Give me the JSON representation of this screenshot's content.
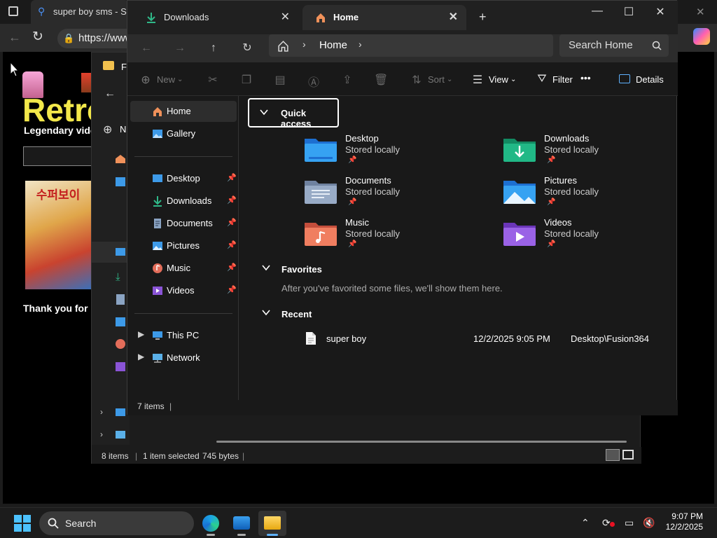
{
  "browser": {
    "tab_title": "super boy sms - Sea",
    "url": "https://www",
    "page": {
      "title": "Retro",
      "subtitle": "Legendary vide",
      "art_text": "수퍼보이",
      "thanks": "Thank you for us"
    }
  },
  "explorer_back": {
    "title_fragment": "Fo",
    "new_fragment": "N",
    "status": {
      "items": "8 items",
      "selected": "1 item selected",
      "size": "745 bytes"
    }
  },
  "explorer": {
    "tabs": [
      {
        "label": "Downloads",
        "icon": "download-icon"
      },
      {
        "label": "Home",
        "icon": "home-icon"
      }
    ],
    "new_tab": "+",
    "window_controls": {
      "minimize": "—",
      "maximize": "☐",
      "close": "✕"
    },
    "breadcrumb": {
      "location": "Home"
    },
    "search": {
      "placeholder": "Search Home"
    },
    "toolbar": {
      "new_label": "New",
      "sort_label": "Sort",
      "view_label": "View",
      "filter_label": "Filter",
      "more_label": "•••",
      "details_label": "Details"
    },
    "nav": {
      "home": "Home",
      "gallery": "Gallery",
      "pinned": [
        {
          "label": "Desktop",
          "color": "#3d9ae8"
        },
        {
          "label": "Downloads",
          "color": "#2fb888"
        },
        {
          "label": "Documents",
          "color": "#8aa3c2"
        },
        {
          "label": "Pictures",
          "color": "#3d9ae8"
        },
        {
          "label": "Music",
          "color": "#e36d5a"
        },
        {
          "label": "Videos",
          "color": "#8a54d6"
        }
      ],
      "this_pc": "This PC",
      "network": "Network"
    },
    "quick_access": {
      "header": "Quick access",
      "folders": [
        {
          "name": "Desktop",
          "sub": "Stored locally",
          "icon": "desktop-folder-icon"
        },
        {
          "name": "Downloads",
          "sub": "Stored locally",
          "icon": "downloads-folder-icon"
        },
        {
          "name": "Documents",
          "sub": "Stored locally",
          "icon": "documents-folder-icon"
        },
        {
          "name": "Pictures",
          "sub": "Stored locally",
          "icon": "pictures-folder-icon"
        },
        {
          "name": "Music",
          "sub": "Stored locally",
          "icon": "music-folder-icon"
        },
        {
          "name": "Videos",
          "sub": "Stored locally",
          "icon": "videos-folder-icon"
        }
      ]
    },
    "favorites": {
      "header": "Favorites",
      "empty_note": "After you've favorited some files, we'll show them here."
    },
    "recent": {
      "header": "Recent",
      "items": [
        {
          "name": "super boy",
          "date": "12/2/2025 9:05 PM",
          "location": "Desktop\\Fusion364"
        }
      ]
    },
    "status": {
      "items": "7 items"
    }
  },
  "taskbar": {
    "search_label": "Search",
    "time": "9:07 PM",
    "date": "12/2/2025"
  }
}
